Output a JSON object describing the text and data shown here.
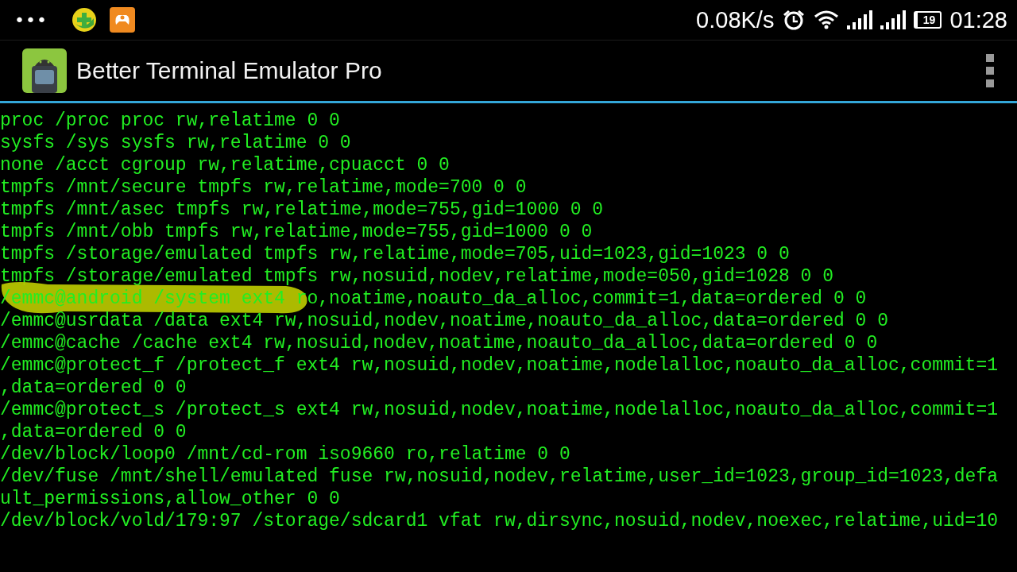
{
  "status_bar": {
    "overflow": "•••",
    "speed": "0.08K/s",
    "battery": "19",
    "time": "01:28"
  },
  "app_bar": {
    "title": "Better Terminal Emulator Pro"
  },
  "terminal": {
    "lines": [
      {
        "text": "proc /proc proc rw,relatime 0 0",
        "highlighted": false
      },
      {
        "text": "sysfs /sys sysfs rw,relatime 0 0",
        "highlighted": false
      },
      {
        "text": "none /acct cgroup rw,relatime,cpuacct 0 0",
        "highlighted": false
      },
      {
        "text": "tmpfs /mnt/secure tmpfs rw,relatime,mode=700 0 0",
        "highlighted": false
      },
      {
        "text": "tmpfs /mnt/asec tmpfs rw,relatime,mode=755,gid=1000 0 0",
        "highlighted": false
      },
      {
        "text": "tmpfs /mnt/obb tmpfs rw,relatime,mode=755,gid=1000 0 0",
        "highlighted": false
      },
      {
        "text": "tmpfs /storage/emulated tmpfs rw,relatime,mode=705,uid=1023,gid=1023 0 0",
        "highlighted": false
      },
      {
        "text": "tmpfs /storage/emulated tmpfs rw,nosuid,nodev,relatime,mode=050,gid=1028 0 0",
        "highlighted": false
      },
      {
        "text": "/emmc@android /system ext4 ro,noatime,noauto_da_alloc,commit=1,data=ordered 0 0",
        "highlighted": true
      },
      {
        "text": "/emmc@usrdata /data ext4 rw,nosuid,nodev,noatime,noauto_da_alloc,data=ordered 0 0",
        "highlighted": false
      },
      {
        "text": "/emmc@cache /cache ext4 rw,nosuid,nodev,noatime,noauto_da_alloc,data=ordered 0 0",
        "highlighted": false
      },
      {
        "text": "/emmc@protect_f /protect_f ext4 rw,nosuid,nodev,noatime,nodelalloc,noauto_da_alloc,commit=1",
        "highlighted": false
      },
      {
        "text": ",data=ordered 0 0",
        "highlighted": false
      },
      {
        "text": "/emmc@protect_s /protect_s ext4 rw,nosuid,nodev,noatime,nodelalloc,noauto_da_alloc,commit=1",
        "highlighted": false
      },
      {
        "text": ",data=ordered 0 0",
        "highlighted": false
      },
      {
        "text": "/dev/block/loop0 /mnt/cd-rom iso9660 ro,relatime 0 0",
        "highlighted": false
      },
      {
        "text": "/dev/fuse /mnt/shell/emulated fuse rw,nosuid,nodev,relatime,user_id=1023,group_id=1023,defa",
        "highlighted": false
      },
      {
        "text": "ult_permissions,allow_other 0 0",
        "highlighted": false
      },
      {
        "text": "/dev/block/vold/179:97 /storage/sdcard1 vfat rw,dirsync,nosuid,nodev,noexec,relatime,uid=10",
        "highlighted": false
      }
    ]
  }
}
